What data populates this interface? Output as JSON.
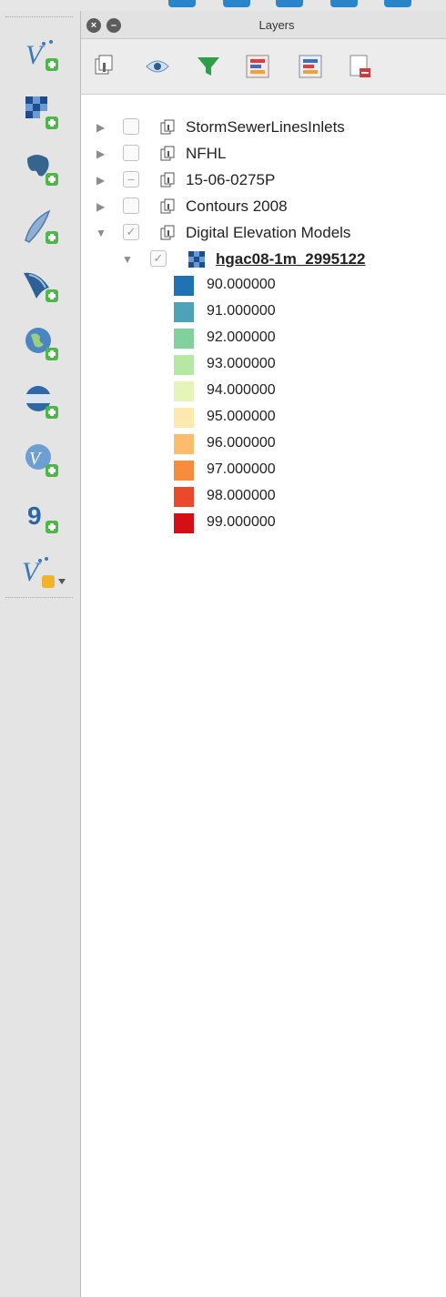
{
  "panel": {
    "title": "Layers"
  },
  "layers": [
    {
      "label": "StormSewerLinesInlets",
      "expanded": false,
      "checked": false
    },
    {
      "label": "NFHL",
      "expanded": false,
      "checked": false
    },
    {
      "label": "15-06-0275P",
      "expanded": false,
      "checked": "partial"
    },
    {
      "label": "Contours 2008",
      "expanded": false,
      "checked": false
    },
    {
      "label": "Digital Elevation Models",
      "expanded": true,
      "checked": true
    }
  ],
  "raster_layer": {
    "label": "hgac08-1m_2995122",
    "checked": true,
    "legend": [
      {
        "value": "90.000000",
        "color": "#1f73b5"
      },
      {
        "value": "91.000000",
        "color": "#4fa3b8"
      },
      {
        "value": "92.000000",
        "color": "#82d19d"
      },
      {
        "value": "93.000000",
        "color": "#b7e7a5"
      },
      {
        "value": "94.000000",
        "color": "#e5f5b9"
      },
      {
        "value": "95.000000",
        "color": "#fde9b0"
      },
      {
        "value": "96.000000",
        "color": "#fbbd6d"
      },
      {
        "value": "97.000000",
        "color": "#f58d3d"
      },
      {
        "value": "98.000000",
        "color": "#ea4a2b"
      },
      {
        "value": "99.000000",
        "color": "#d50f16"
      }
    ]
  },
  "left_toolbar_icons": [
    "add-vector-layer-icon",
    "add-raster-layer-icon",
    "add-postgis-layer-icon",
    "add-spatialite-layer-icon",
    "add-mssql-layer-icon",
    "add-wms-layer-icon",
    "add-wcs-layer-icon",
    "add-wfs-layer-icon",
    "add-delimited-text-layer-icon",
    "new-shapefile-layer-icon"
  ],
  "panel_toolbar_icons": [
    "add-group-icon",
    "manage-visibility-icon",
    "filter-legend-icon",
    "expand-all-icon",
    "collapse-all-icon",
    "remove-layer-icon"
  ]
}
